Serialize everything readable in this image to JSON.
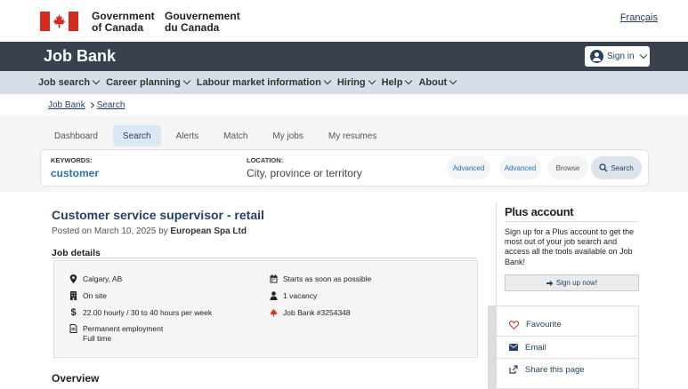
{
  "gov": {
    "en_line1": "Government",
    "en_line2": "of Canada",
    "fr_line1": "Gouvernement",
    "fr_line2": "du Canada",
    "lang_link": "Français"
  },
  "app": {
    "title": "Job Bank",
    "signin_label": "Sign in"
  },
  "menu": [
    {
      "label": "Job search"
    },
    {
      "label": "Career planning"
    },
    {
      "label": "Labour market information"
    },
    {
      "label": "Hiring"
    },
    {
      "label": "Help"
    },
    {
      "label": "About"
    }
  ],
  "breadcrumb": {
    "home": "Job Bank",
    "current": "Search"
  },
  "tabs": [
    {
      "label": "Dashboard"
    },
    {
      "label": "Search"
    },
    {
      "label": "Alerts"
    },
    {
      "label": "Match"
    },
    {
      "label": "My jobs"
    },
    {
      "label": "My resumes"
    }
  ],
  "search": {
    "keywords_label": "KEYWORDS:",
    "keywords_value": "customer",
    "location_label": "LOCATION:",
    "location_placeholder": "City, province or territory",
    "advanced1": "Advanced",
    "advanced2": "Advanced",
    "browse": "Browse",
    "search_button": "Search"
  },
  "job": {
    "title": "Customer service supervisor - retail",
    "posted_prefix": "Posted on March 10, 2025 by",
    "employer": "European Spa Ltd",
    "details_heading": "Job details",
    "location": "Calgary, AB",
    "site": "On site",
    "pay": "22.00 hourly / 30 to 40 hours per week",
    "employment1": "Permanent employment",
    "employment2": "Full time",
    "start": "Starts as soon as possible",
    "vacancy": "1 vacancy",
    "job_number": "Job Bank #3254348",
    "overview_heading": "Overview"
  },
  "sidebar": {
    "plus_title": "Plus account",
    "plus_text": "Sign up for a Plus account to get the most out of your job search and access all the tools available on Job Bank!",
    "signup_label": "Sign up now!",
    "favourite": "Favourite",
    "email": "Email",
    "share": "Share this page"
  },
  "colors": {
    "accent": "#284162",
    "link": "#2572b4",
    "app_bar": "#38414d",
    "menu_bar": "#d6dee7",
    "flag_red": "#d52b1e"
  }
}
